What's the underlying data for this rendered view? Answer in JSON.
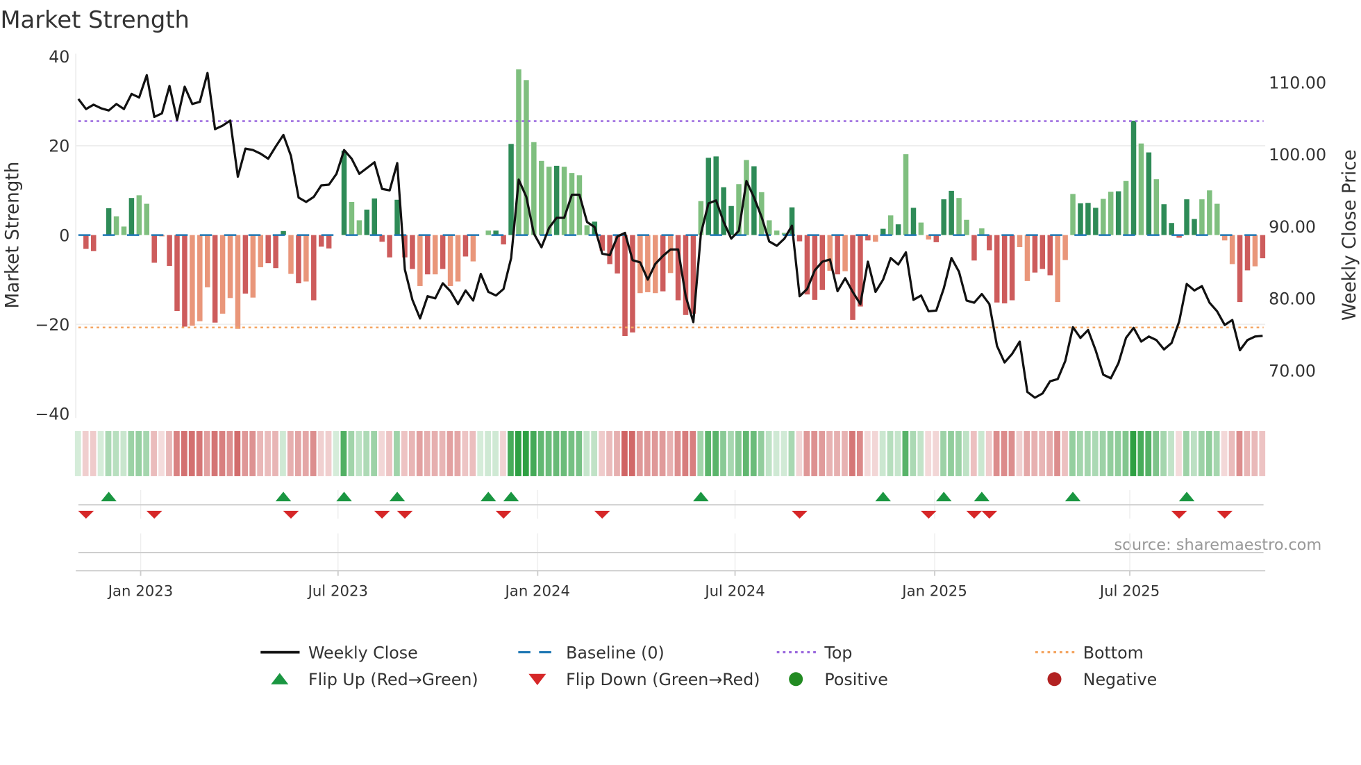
{
  "chart_data": {
    "type": "bar",
    "title": "Market Strength",
    "ylabel": "Market Strength",
    "ylabel_right": "Weekly Close Price",
    "ylim": [
      -40,
      40
    ],
    "ylim_right": [
      63.5,
      114
    ],
    "yticks": [
      "40",
      "20",
      "0",
      "−20",
      "−40"
    ],
    "ytick_values": [
      40,
      20,
      0,
      -20,
      -40
    ],
    "yticks_right": [
      "110.00",
      "100.00",
      "90.00",
      "80.00",
      "70.00"
    ],
    "ytick_right_values": [
      110,
      100,
      90,
      80,
      70
    ],
    "xticks": [
      {
        "label": "Jan 2023",
        "week": 8.2
      },
      {
        "label": "Jul 2023",
        "week": 34.2
      },
      {
        "label": "Jan 2024",
        "week": 60.5
      },
      {
        "label": "Jul 2024",
        "week": 86.5
      },
      {
        "label": "Jan 2025",
        "week": 112.8
      },
      {
        "label": "Jul 2025",
        "week": 138.5
      }
    ],
    "top_level": 25.5,
    "bottom_level": -20.7,
    "baseline": 0,
    "strength": [
      0,
      -3.1,
      -3.6,
      0,
      6.0,
      4.2,
      1.9,
      8.3,
      8.9,
      7.0,
      -6.2,
      -0.3,
      -6.9,
      -17.0,
      -20.5,
      -20.3,
      -19.3,
      -11.7,
      -19.6,
      -17.6,
      -14.1,
      -21.0,
      -13.1,
      -14.0,
      -7.2,
      -6.3,
      -7.4,
      0.9,
      -8.7,
      -10.8,
      -10.4,
      -14.6,
      -2.6,
      -3.0,
      0,
      18.9,
      7.4,
      3.3,
      5.7,
      8.2,
      -1.5,
      -5.0,
      7.9,
      -5.0,
      -7.6,
      -11.4,
      -8.8,
      -8.8,
      -7.6,
      -11.4,
      -10.4,
      -4.8,
      -5.9,
      0,
      1.0,
      1.0,
      -2.1,
      20.4,
      37.1,
      34.7,
      20.8,
      16.6,
      15.3,
      15.5,
      15.3,
      13.9,
      13.4,
      2.2,
      3.0,
      -3.5,
      -6.5,
      -8.6,
      -22.6,
      -21.8,
      -13.0,
      -12.8,
      -13.0,
      -12.6,
      -8.5,
      -14.6,
      -17.9,
      -17.6,
      7.6,
      17.3,
      17.6,
      10.7,
      6.5,
      11.4,
      16.8,
      15.4,
      9.6,
      3.3,
      1.0,
      0.5,
      6.2,
      -1.4,
      -13.3,
      -14.5,
      -12.3,
      -8.0,
      -8.8,
      -8.1,
      -19.0,
      -16.0,
      -1.2,
      -1.5,
      1.4,
      4.4,
      2.4,
      18.1,
      6.1,
      2.8,
      -1.0,
      -1.6,
      8.0,
      9.9,
      8.3,
      3.4,
      -5.7,
      1.5,
      -3.4,
      -15.1,
      -15.3,
      -14.6,
      -2.7,
      -10.3,
      -8.4,
      -7.6,
      -9.0,
      -15.0,
      -5.6,
      9.2,
      7.1,
      7.2,
      6.1,
      8.1,
      9.7,
      9.8,
      12.1,
      25.6,
      20.5,
      18.5,
      12.5,
      6.9,
      2.7,
      -0.6,
      8.0,
      3.6,
      8.0,
      10.0,
      7.0,
      -1.2,
      -6.5,
      -15.0,
      -7.9,
      -7.0,
      -5.2
    ],
    "shade": "ddd-dlldlldldddllldllldlldddldlddd-dlldddddddldldlld-dldddllllldllllddddddllldldddlddddlldlllldddddldldddldldldlldddlldlddddlldddllldddlldldldldddddlllllddlddlddddlll",
    "weekly_close": [
      107.7,
      106.3,
      106.9,
      106.4,
      106.1,
      107.0,
      106.3,
      108.4,
      107.9,
      111.0,
      105.2,
      105.7,
      109.5,
      104.8,
      109.4,
      107.0,
      107.3,
      111.3,
      103.5,
      104.0,
      104.7,
      96.9,
      100.8,
      100.6,
      100.1,
      99.4,
      101.1,
      102.7,
      99.8,
      94.0,
      93.4,
      94.1,
      95.7,
      95.8,
      97.3,
      100.6,
      99.4,
      97.3,
      98.1,
      98.9,
      95.2,
      95.0,
      98.8,
      84.0,
      79.8,
      77.2,
      80.3,
      80.0,
      82.1,
      81.0,
      79.2,
      81.1,
      79.7,
      83.4,
      80.9,
      80.4,
      81.3,
      85.6,
      96.5,
      94.1,
      89.0,
      87.1,
      89.8,
      91.2,
      91.2,
      94.4,
      94.4,
      90.6,
      89.9,
      86.2,
      86.0,
      88.6,
      89.1,
      85.3,
      85.0,
      82.6,
      84.8,
      85.9,
      86.8,
      86.8,
      80.3,
      76.7,
      89.0,
      93.2,
      93.6,
      90.6,
      88.3,
      89.4,
      96.3,
      94.0,
      91.3,
      87.9,
      87.3,
      88.3,
      90.1,
      80.3,
      81.3,
      83.9,
      85.1,
      85.4,
      81.0,
      82.8,
      80.9,
      79.2,
      85.1,
      80.9,
      82.6,
      85.6,
      84.7,
      86.4,
      79.8,
      80.4,
      78.2,
      78.3,
      81.4,
      85.6,
      83.7,
      79.7,
      79.4,
      80.6,
      79.2,
      73.4,
      71.1,
      72.3,
      74.0,
      67.0,
      66.2,
      66.8,
      68.5,
      68.8,
      71.3,
      76.0,
      74.5,
      75.6,
      72.8,
      69.4,
      68.9,
      71.0,
      74.5,
      75.9,
      74.0,
      74.7,
      74.2,
      72.9,
      73.8,
      76.8,
      82.0,
      81.1,
      81.7,
      79.4,
      78.2,
      76.3,
      77.0,
      72.8,
      74.2,
      74.7,
      74.8
    ],
    "flip_up_weeks": [
      4,
      27,
      35,
      42,
      54,
      57,
      82,
      106,
      114,
      119,
      131,
      146
    ],
    "flip_down_weeks": [
      1,
      10,
      28,
      40,
      43,
      56,
      69,
      95,
      112,
      118,
      120,
      145,
      151
    ],
    "legend": [
      {
        "label": "Weekly Close",
        "kind": "line"
      },
      {
        "label": "Baseline (0)",
        "kind": "dash"
      },
      {
        "label": "Top",
        "kind": "dot-top"
      },
      {
        "label": "Bottom",
        "kind": "dot-bottom"
      },
      {
        "label": "Flip Up (Red→Green)",
        "kind": "tri-up"
      },
      {
        "label": "Flip Down (Green→Red)",
        "kind": "tri-down"
      },
      {
        "label": "Positive",
        "kind": "dot-pos"
      },
      {
        "label": "Negative",
        "kind": "dot-neg"
      }
    ],
    "legend_position": "bottom",
    "source": "source: sharemaestro.com"
  },
  "colors": {
    "pos_strong": "#2e8b57",
    "pos_weak": "#7fbf7f",
    "neg_strong": "#cd5c5c",
    "neg_weak": "#e9967a",
    "baseline": "#1f77b4",
    "top": "#9966dd",
    "bottom": "#f4a460",
    "close": "#111111",
    "flip_up": "#1a9641",
    "flip_down": "#d62728",
    "positive": "#228b22",
    "negative": "#b22222"
  }
}
